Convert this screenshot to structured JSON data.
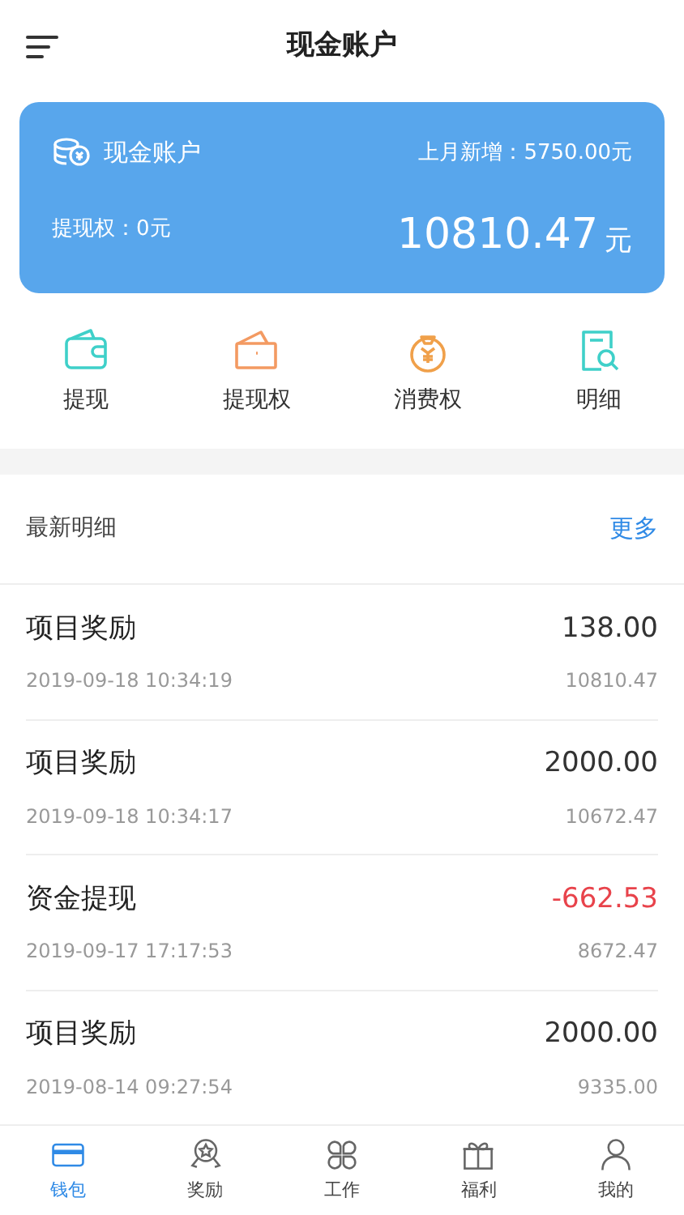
{
  "header": {
    "title": "现金账户"
  },
  "account_card": {
    "title": "现金账户",
    "last_month_label": "上月新增：5750.00元",
    "withdraw_right": "提现权：0元",
    "balance": "10810.47",
    "currency": "元"
  },
  "actions": [
    {
      "label": "提现",
      "kind": "wallet",
      "color": "#3fd0c9"
    },
    {
      "label": "提现权",
      "kind": "cards",
      "color": "#f39a62"
    },
    {
      "label": "消费权",
      "kind": "moneybag",
      "color": "#f0a04a"
    },
    {
      "label": "明细",
      "kind": "document",
      "color": "#3fd0c9"
    }
  ],
  "recent": {
    "title": "最新明细",
    "more_link": "更多"
  },
  "transactions": [
    {
      "title": "项目奖励",
      "amount": "138.00",
      "time": "2019-09-18 10:34:19",
      "balance": "10810.47",
      "kind": "credit"
    },
    {
      "title": "项目奖励",
      "amount": "2000.00",
      "time": "2019-09-18 10:34:17",
      "balance": "10672.47",
      "kind": "credit"
    },
    {
      "title": "资金提现",
      "amount": "-662.53",
      "time": "2019-09-17 17:17:53",
      "balance": "8672.47",
      "kind": "debit"
    },
    {
      "title": "项目奖励",
      "amount": "2000.00",
      "time": "2019-08-14 09:27:54",
      "balance": "9335.00",
      "kind": "credit"
    }
  ],
  "bottom_nav": [
    {
      "label": "钱包",
      "kind": "card",
      "selected": true
    },
    {
      "label": "奖励",
      "kind": "medal",
      "selected": false
    },
    {
      "label": "工作",
      "kind": "clover",
      "selected": false
    },
    {
      "label": "福利",
      "kind": "gift",
      "selected": false
    },
    {
      "label": "我的",
      "kind": "person",
      "selected": false
    }
  ]
}
